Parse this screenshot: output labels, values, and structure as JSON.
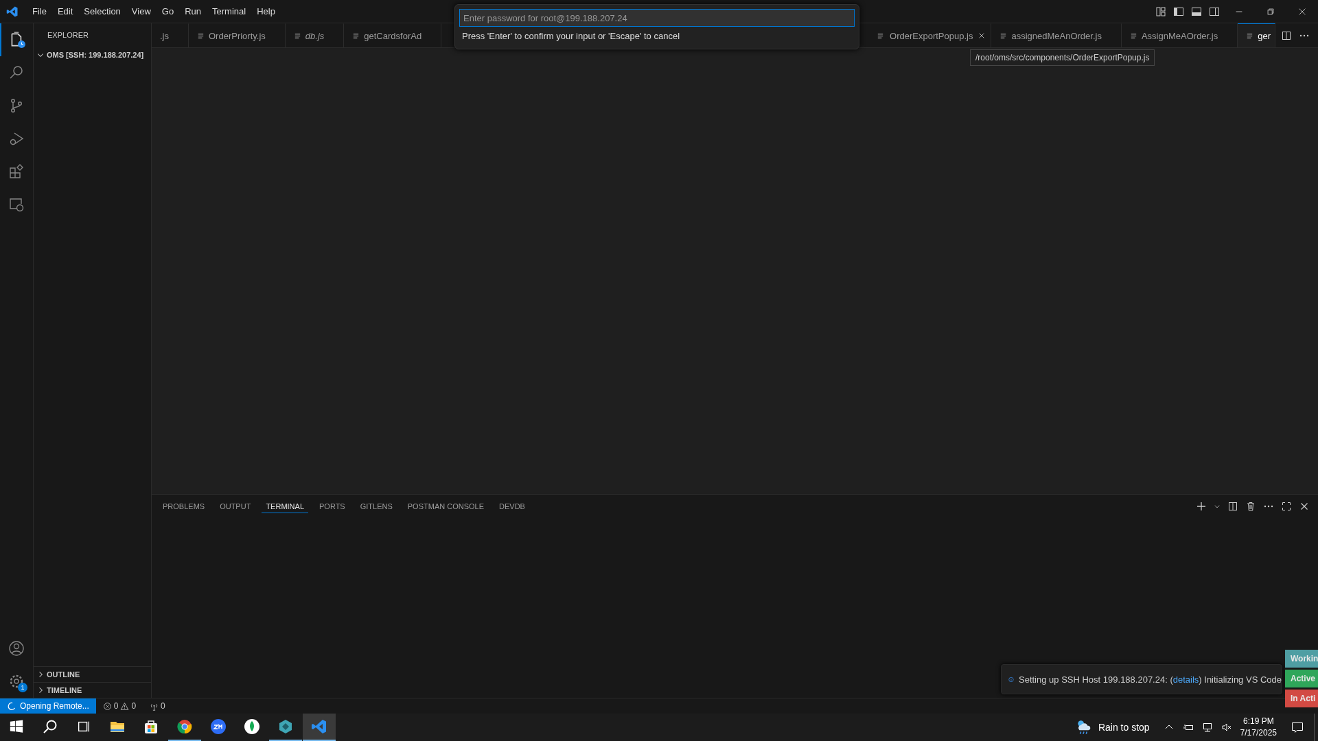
{
  "title_bar": {
    "menus": [
      "File",
      "Edit",
      "Selection",
      "View",
      "Go",
      "Run",
      "Terminal",
      "Help"
    ]
  },
  "quick_input": {
    "placeholder": "Enter password for root@199.188.207.24",
    "message": "Press 'Enter' to confirm your input or 'Escape' to cancel"
  },
  "activity_bar": {
    "top": [
      {
        "kind": "explorer",
        "selected": true
      },
      {
        "kind": "search",
        "selected": false
      },
      {
        "kind": "source-control",
        "selected": false
      },
      {
        "kind": "run",
        "selected": false
      },
      {
        "kind": "extensions",
        "selected": false
      },
      {
        "kind": "remote",
        "selected": false
      }
    ],
    "bottom": [
      {
        "kind": "account"
      },
      {
        "kind": "settings",
        "badge": "1"
      }
    ]
  },
  "sidebar": {
    "title": "EXPLORER",
    "sections": [
      {
        "label": "OMS [SSH: 199.188.207.24]",
        "expanded": true
      },
      {
        "label": "OUTLINE",
        "expanded": false
      },
      {
        "label": "TIMELINE",
        "expanded": false
      }
    ]
  },
  "editor_tabs": {
    "before_prompt": [
      {
        "label": ".js",
        "italic": false,
        "selected": false,
        "hovered": false
      },
      {
        "label": "OrderPriorty.js",
        "italic": false,
        "selected": false,
        "hovered": false
      },
      {
        "label": "db.js",
        "italic": true,
        "selected": false,
        "hovered": false
      },
      {
        "label": "getCardsforAd",
        "italic": false,
        "selected": false,
        "hovered": false
      }
    ],
    "after_prompt": [
      {
        "label": "OrderExportPopup.js",
        "italic": false,
        "selected": false,
        "hovered": true
      },
      {
        "label": "assignedMeAnOrder.js",
        "italic": false,
        "selected": false,
        "hovered": false
      },
      {
        "label": "AssignMeAOrder.js",
        "italic": false,
        "selected": false,
        "hovered": false
      },
      {
        "label": "ger",
        "italic": false,
        "selected": true,
        "hovered": false
      }
    ]
  },
  "tooltip": "/root/oms/src/components/OrderExportPopup.js",
  "panel": {
    "tabs": [
      {
        "label": "PROBLEMS",
        "selected": false
      },
      {
        "label": "OUTPUT",
        "selected": false
      },
      {
        "label": "TERMINAL",
        "selected": true
      },
      {
        "label": "PORTS",
        "selected": false
      },
      {
        "label": "GITLENS",
        "selected": false
      },
      {
        "label": "POSTMAN CONSOLE",
        "selected": false
      },
      {
        "label": "DEVDB",
        "selected": false
      }
    ]
  },
  "notification": {
    "text": "Setting up SSH Host 199.188.207.24: (",
    "link": "details",
    "text_after": ") Initializing VS Code"
  },
  "status_chips": [
    {
      "label": "Workin",
      "color": "#4f9ea3"
    },
    {
      "label": "Active",
      "color": "#2fa65a"
    },
    {
      "label": "In Acti",
      "color": "#d24a43"
    }
  ],
  "status_bar": {
    "remote": "Opening Remote...",
    "errors": "0",
    "warnings": "0",
    "ports": "0"
  },
  "taskbar": {
    "apps": [
      {
        "kind": "start",
        "running": false,
        "selected": false
      },
      {
        "kind": "search",
        "running": false,
        "selected": false
      },
      {
        "kind": "task-view",
        "running": false,
        "selected": false
      },
      {
        "kind": "folder",
        "running": false,
        "selected": false
      },
      {
        "kind": "store",
        "running": false,
        "selected": false
      },
      {
        "kind": "browser",
        "running": true,
        "selected": false
      },
      {
        "kind": "meeting",
        "running": false,
        "selected": false
      },
      {
        "kind": "leaf",
        "running": false,
        "selected": false
      },
      {
        "kind": "cube",
        "running": true,
        "selected": false
      },
      {
        "kind": "code",
        "running": true,
        "selected": true
      }
    ],
    "weather": "Rain to stop",
    "time": "6:19 PM",
    "date": "7/17/2025"
  }
}
